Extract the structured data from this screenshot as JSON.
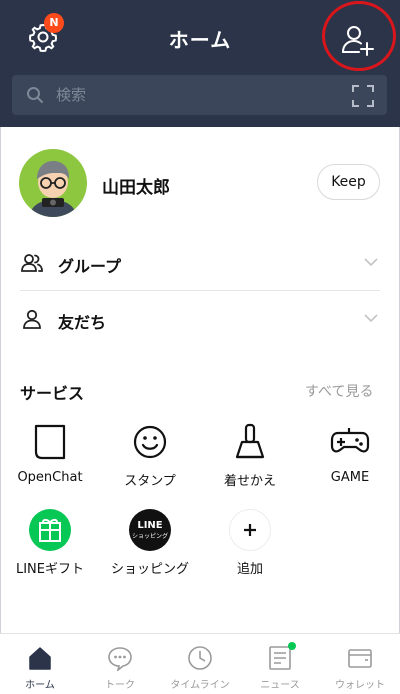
{
  "header": {
    "title": "ホーム",
    "settings_badge": "N",
    "search_placeholder": "検索"
  },
  "profile": {
    "name": "山田太郎",
    "keep_label": "Keep"
  },
  "sections": [
    {
      "label": "グループ",
      "icon": "group-icon"
    },
    {
      "label": "友だち",
      "icon": "person-icon"
    }
  ],
  "services": {
    "title": "サービス",
    "see_all": "すべて見る",
    "items": [
      {
        "label": "OpenChat",
        "icon": "openchat-icon"
      },
      {
        "label": "スタンプ",
        "icon": "smiley-icon"
      },
      {
        "label": "着せかえ",
        "icon": "brush-icon"
      },
      {
        "label": "GAME",
        "icon": "gamepad-icon"
      },
      {
        "label": "LINEギフト",
        "icon": "gift-icon"
      },
      {
        "label": "ショッピング",
        "icon": "line-shopping-icon",
        "logo_line1": "LINE",
        "logo_line2": "ショッピング"
      },
      {
        "label": "追加",
        "icon": "plus-icon"
      }
    ]
  },
  "tabs": [
    {
      "label": "ホーム",
      "icon": "home-icon",
      "active": true
    },
    {
      "label": "トーク",
      "icon": "chat-bubble-icon"
    },
    {
      "label": "タイムライン",
      "icon": "clock-icon"
    },
    {
      "label": "ニュース",
      "icon": "news-icon",
      "has_dot": true
    },
    {
      "label": "ウォレット",
      "icon": "wallet-icon"
    }
  ],
  "colors": {
    "header_bg": "#2b3448",
    "accent_green": "#07c755",
    "badge": "#ff4a1c",
    "highlight_ring": "#d8161b"
  }
}
